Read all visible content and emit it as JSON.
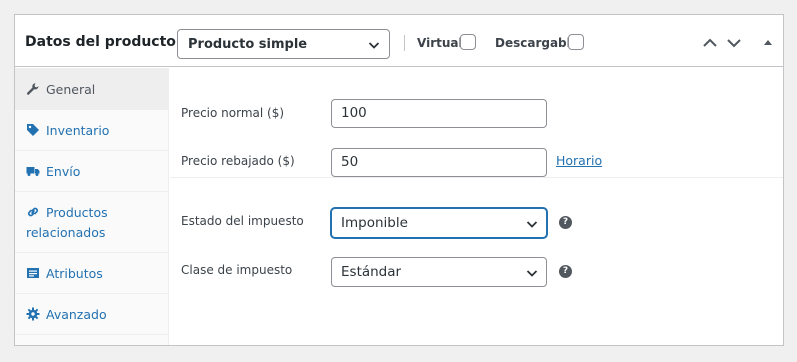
{
  "header": {
    "title": "Datos del producto —",
    "product_type": "Producto simple",
    "virtual_label": "Virtual:",
    "virtual_checked": false,
    "downloadable_label": "Descargable:",
    "downloadable_checked": false
  },
  "tabs": [
    {
      "label": "General",
      "icon": "wrench-icon",
      "active": true
    },
    {
      "label": "Inventario",
      "icon": "tag-icon",
      "active": false
    },
    {
      "label": "Envío",
      "icon": "truck-icon",
      "active": false
    },
    {
      "label": "Productos relacionados",
      "icon": "link-icon",
      "active": false
    },
    {
      "label": "Atributos",
      "icon": "list-icon",
      "active": false
    },
    {
      "label": "Avanzado",
      "icon": "gear-icon",
      "active": false
    }
  ],
  "general": {
    "regular_price_label": "Precio normal ($)",
    "regular_price_value": "100",
    "sale_price_label": "Precio rebajado ($)",
    "sale_price_value": "50",
    "schedule_link": "Horario",
    "tax_status_label": "Estado del impuesto",
    "tax_status_value": "Imponible",
    "tax_class_label": "Clase de impuesto",
    "tax_class_value": "Estándar",
    "help_glyph": "?"
  },
  "colors": {
    "accent": "#2271b1",
    "border": "#c3c4c7",
    "background": "#f0f0f1"
  }
}
